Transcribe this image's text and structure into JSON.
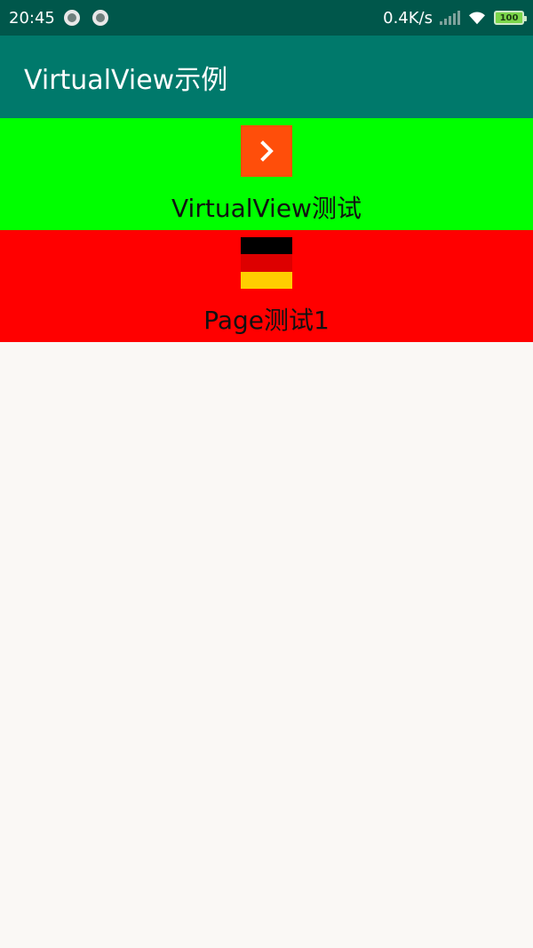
{
  "status_bar": {
    "time": "20:45",
    "network_speed": "0.4K/s",
    "battery_level": "100",
    "icons": [
      "notification-icon",
      "notification-icon",
      "signal-icon",
      "wifi-icon",
      "battery-icon"
    ]
  },
  "app_bar": {
    "title": "VirtualView示例",
    "color": "#00796b"
  },
  "list": {
    "items": [
      {
        "label": "VirtualView测试",
        "icon": "chevron-right-icon",
        "background": "#00ff00"
      },
      {
        "label": "Page测试1",
        "icon": "germany-flag-icon",
        "background": "#ff0000"
      }
    ]
  }
}
